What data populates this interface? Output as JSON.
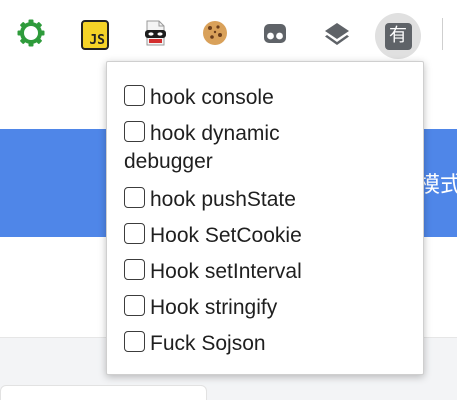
{
  "toolbar": {
    "extensions": [
      {
        "icon": "gear-outline-icon",
        "color": "#2e9b3b"
      },
      {
        "icon": "js-icon",
        "label": "JS",
        "color": "#f5d327"
      },
      {
        "icon": "masked-document-icon"
      },
      {
        "icon": "cookie-icon",
        "color": "#c98a3b"
      },
      {
        "icon": "incognito-icon",
        "color": "#5f6368"
      },
      {
        "icon": "stacked-layers-icon",
        "color": "#5f6368"
      },
      {
        "icon": "you-extension-icon",
        "label": "有",
        "active": true
      }
    ]
  },
  "page": {
    "band_text": "模式",
    "band_color": "#4f86e8"
  },
  "popup": {
    "options": [
      {
        "label": "hook console",
        "checked": false
      },
      {
        "label": "hook dynamic debugger",
        "checked": false
      },
      {
        "label": "hook pushState",
        "checked": false
      },
      {
        "label": "Hook SetCookie",
        "checked": false
      },
      {
        "label": "Hook setInterval",
        "checked": false
      },
      {
        "label": "Hook stringify",
        "checked": false
      },
      {
        "label": "Fuck Sojson",
        "checked": false
      }
    ]
  }
}
